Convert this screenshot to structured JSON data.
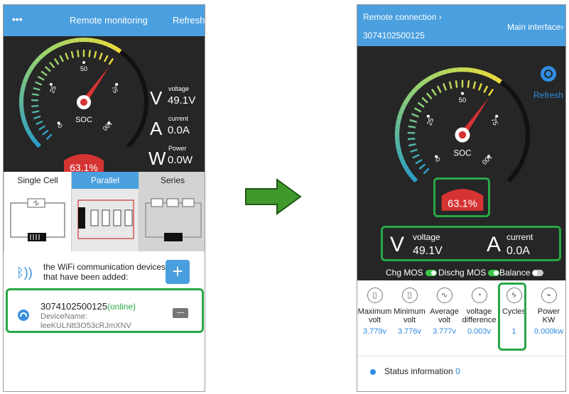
{
  "left": {
    "header": {
      "menu_icon": "•••",
      "title": "Remote monitoring",
      "refresh": "Refresh"
    },
    "gauge": {
      "ticks": [
        "0",
        "25",
        "50",
        "75",
        "100"
      ],
      "center_label": "SOC",
      "soc": "63.1%",
      "soc_fraction": 0.631
    },
    "readings": [
      {
        "label": "voltage",
        "value": "49.1V"
      },
      {
        "label": "current",
        "value": "0.0A"
      },
      {
        "label": "Power",
        "value": "0.0W"
      }
    ],
    "tabs": [
      "Single Cell",
      "Parallel",
      "Series"
    ],
    "add_section": {
      "text_line1": "the WiFi communication devices",
      "text_line2": "that have been added:",
      "add_button": "+"
    },
    "device": {
      "id": "3074102500125",
      "status": "(online)",
      "name_label": "DeviceName:",
      "name_value": "leeKULNtt3O53cRJmXNV",
      "remove_button": "—"
    }
  },
  "right": {
    "header": {
      "connection": "Remote connection",
      "device_id": "3074102500125",
      "main_interface": "Main interface"
    },
    "refresh": "Refresh",
    "gauge": {
      "ticks": [
        "0",
        "25",
        "50",
        "75",
        "100"
      ],
      "center_label": "SOC",
      "soc": "63.1%",
      "soc_fraction": 0.631
    },
    "readings": [
      {
        "label": "voltage",
        "value": "49.1V"
      },
      {
        "label": "current",
        "value": "0.0A"
      }
    ],
    "mos": [
      {
        "label": "Chg MOS",
        "state": "on"
      },
      {
        "label": "Dischg MOS",
        "state": "on"
      },
      {
        "label": "Balance",
        "state": "off"
      }
    ],
    "stats": [
      {
        "label": "Maximum volt",
        "value": "3.779v"
      },
      {
        "label": "Minimum volt",
        "value": "3.776v"
      },
      {
        "label": "Average volt",
        "value": "3.777v"
      },
      {
        "label": "voltage difference",
        "value": "0.003v"
      },
      {
        "label": "Cycles",
        "value": "1"
      },
      {
        "label": "Power KW",
        "value": "0.000kw"
      }
    ],
    "status_info": {
      "label": "Status information",
      "count": "0"
    }
  },
  "colors": {
    "header_blue": "#4a9fdf",
    "panel_dark": "#262626",
    "highlight_green": "#28a745",
    "soc_red": "#d63333",
    "arrow_green": "#3f9a2b"
  }
}
